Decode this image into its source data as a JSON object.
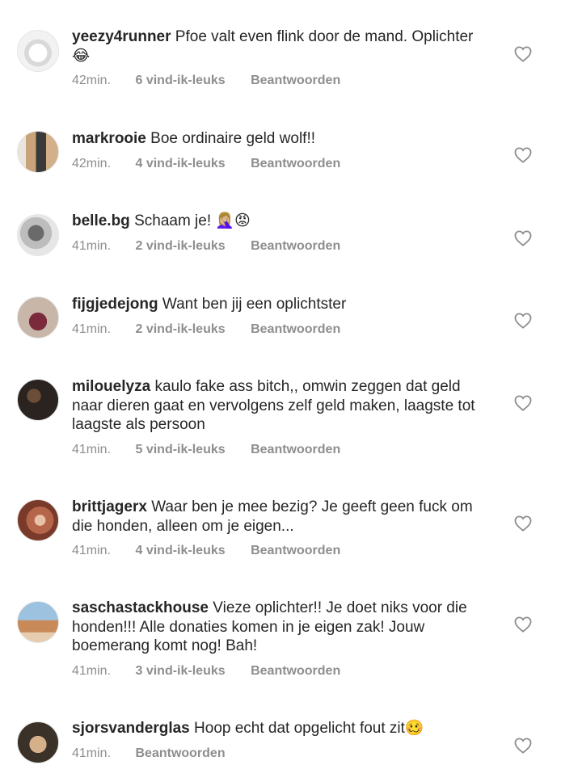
{
  "comments": [
    {
      "username": "yeezy4runner",
      "text": "Pfoe valt even flink door de mand. Oplichter 😂",
      "time": "42min.",
      "likes": "6 vind-ik-leuks",
      "reply": "Beantwoorden",
      "avatar_colors": [
        "#f2f2f2",
        "#d9d9d9"
      ]
    },
    {
      "username": "markrooie",
      "text": "Boe ordinaire geld wolf!!",
      "time": "42min.",
      "likes": "4 vind-ik-leuks",
      "reply": "Beantwoorden",
      "avatar_colors": [
        "#3a3a3a",
        "#c9a47a"
      ]
    },
    {
      "username": "belle.bg",
      "text": "Schaam je! 🤦🏼‍♀️😡",
      "time": "41min.",
      "likes": "2 vind-ik-leuks",
      "reply": "Beantwoorden",
      "avatar_colors": [
        "#dcdcdc",
        "#5a5a5a"
      ]
    },
    {
      "username": "fijgjedejong",
      "text": "Want ben jij een oplichtster",
      "time": "41min.",
      "likes": "2 vind-ik-leuks",
      "reply": "Beantwoorden",
      "avatar_colors": [
        "#c8b6a8",
        "#7a2a3a"
      ]
    },
    {
      "username": "milouelyza",
      "text": "kaulo fake ass bitch,, omwin zeggen dat geld naar dieren gaat en vervolgens zelf geld maken, laagste tot laagste als persoon",
      "time": "41min.",
      "likes": "5 vind-ik-leuks",
      "reply": "Beantwoorden",
      "avatar_colors": [
        "#2a2320",
        "#6b4e3a"
      ]
    },
    {
      "username": "brittjagerx",
      "text": "Waar ben je mee bezig? Je geeft geen fuck om die honden, alleen om je eigen...",
      "time": "41min.",
      "likes": "4 vind-ik-leuks",
      "reply": "Beantwoorden",
      "avatar_colors": [
        "#b5654a",
        "#e8c2a8"
      ]
    },
    {
      "username": "saschastackhouse",
      "text": "Vieze oplichter!! Je doet niks voor die honden!!! Alle donaties komen in je eigen zak! Jouw boemerang komt nog! Bah!",
      "time": "41min.",
      "likes": "3 vind-ik-leuks",
      "reply": "Beantwoorden",
      "avatar_colors": [
        "#9cc2e0",
        "#c98a5a"
      ]
    },
    {
      "username": "sjorsvanderglas",
      "text": "Hoop echt dat opgelicht fout zit🥴",
      "time": "41min.",
      "likes": "",
      "reply": "Beantwoorden",
      "avatar_colors": [
        "#3a3128",
        "#d6b08a"
      ]
    }
  ],
  "colors": {
    "text": "#262626",
    "meta": "#8e8e8e",
    "heart": "#8e8e8e"
  },
  "icons": {
    "like": "heart-outline-icon"
  }
}
